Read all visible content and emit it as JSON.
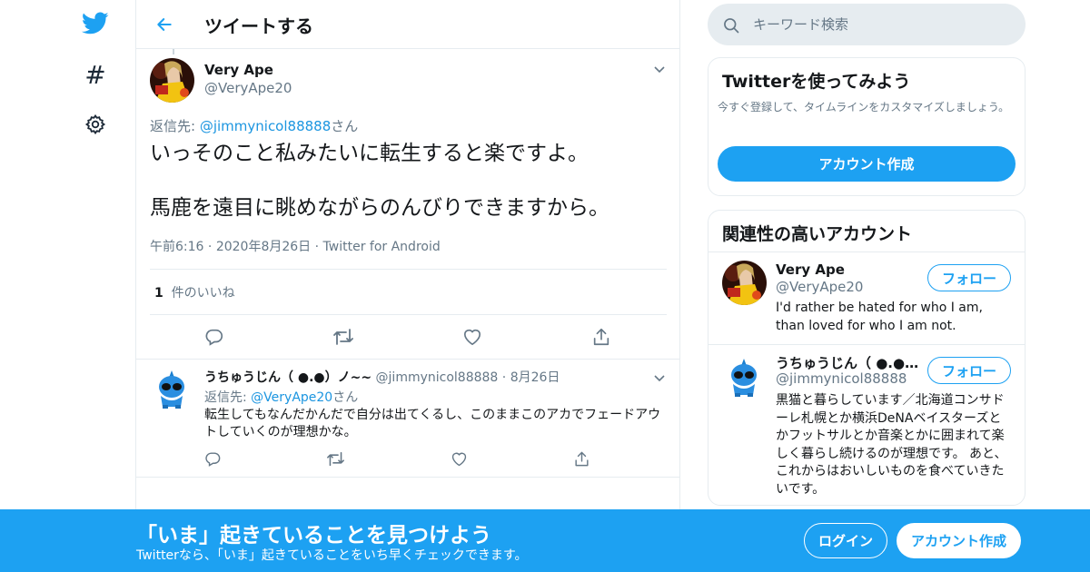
{
  "nav": {
    "icons": [
      "twitter-bird-icon",
      "hashtag-icon",
      "settings-gear-icon"
    ],
    "hashtag_glyph": "#"
  },
  "header": {
    "title": "ツイートする"
  },
  "tweet": {
    "name": "Very Ape",
    "handle": "@VeryApe20",
    "reply_prefix": "返信先: ",
    "reply_handle": "@jimmynicol88888",
    "reply_suffix": "さん",
    "body_line1": "いっそのこと私みたいに転生すると楽ですよ。",
    "body_line2": "馬鹿を遠目に眺めながらのんびりできますから。",
    "time": "午前6:16",
    "date": "2020年8月26日",
    "source": "Twitter for Android",
    "sep": "·",
    "likes_count": "1",
    "likes_label": "件のいいね"
  },
  "reply": {
    "name": "うちゅうじん（ ●.●）ノ~~",
    "handle": "@jimmynicol88888",
    "sep": "·",
    "date": "8月26日",
    "reply_prefix": "返信先: ",
    "reply_handle": "@VeryApe20",
    "reply_suffix": "さん",
    "body": "転生してもなんだかんだで自分は出てくるし、このままこのアカでフェードアウトしていくのが理想かな。"
  },
  "search": {
    "placeholder": "キーワード検索"
  },
  "signup_card": {
    "title": "Twitterを使ってみよう",
    "desc": "今すぐ登録して、タイムラインをカスタマイズしましょう。",
    "button": "アカウント作成"
  },
  "related": {
    "title": "関連性の高いアカウント",
    "accounts": [
      {
        "name": "Very Ape",
        "handle": "@VeryApe20",
        "follow": "フォロー",
        "bio": "I'd rather be hated for who I am, than loved for who I am not."
      },
      {
        "name": "うちゅうじん（ ●.●）ノ~~",
        "handle": "@jimmynicol88888",
        "follow": "フォロー",
        "bio": "黒猫と暮らしています／北海道コンサドーレ札幌とか横浜DeNAベイスターズとかフットサルとか音楽とかに囲まれて楽しく暮らし続けるのが理想です。 あと、これからはおいしいものを食べていきたいです。"
      }
    ]
  },
  "banner": {
    "headline": "「いま」起きていることを見つけよう",
    "sub": "Twitterなら、「いま」起きていることをいち早くチェックできます。",
    "login": "ログイン",
    "create": "アカウント作成"
  },
  "colors": {
    "accent": "#1da1f2",
    "link": "#1b95e0",
    "text_secondary": "#657786",
    "border": "#e6ecf0"
  }
}
